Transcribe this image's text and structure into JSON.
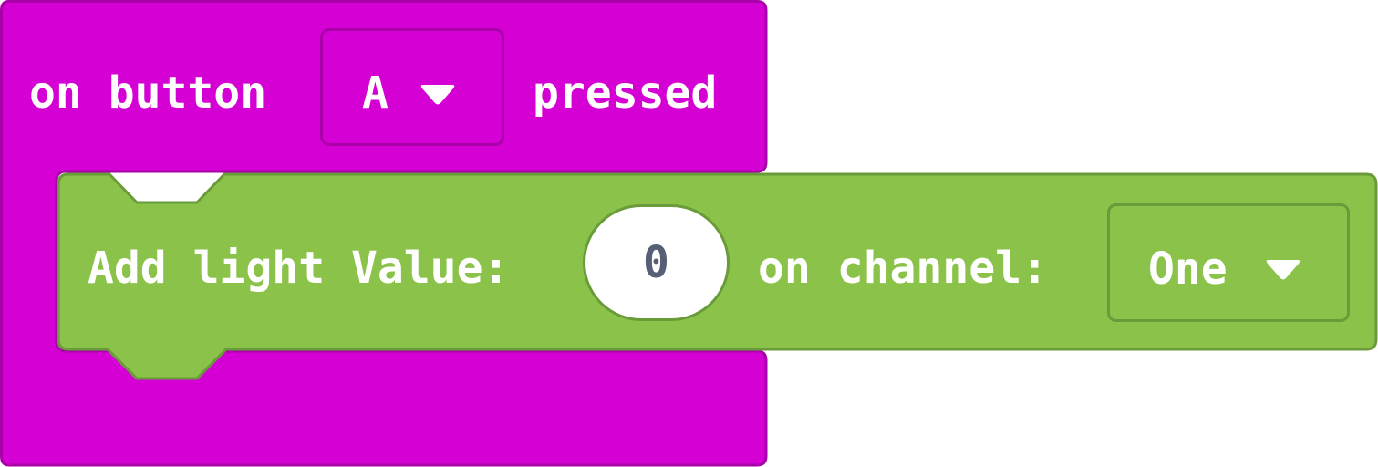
{
  "colors": {
    "event_block_fill": "#d400d4",
    "event_block_stroke": "#aa00aa",
    "statement_block_fill": "#8bc34a",
    "statement_block_stroke": "#6a9b3a",
    "text": "#ffffff",
    "number_text": "#575e75"
  },
  "event_block": {
    "label_prefix": "on button",
    "button_dropdown": {
      "selected": "A",
      "icon": "chevron-down-icon"
    },
    "label_suffix": "pressed"
  },
  "statement_block": {
    "label_prefix": "Add light Value:",
    "value_input": "0",
    "label_mid": "on channel:",
    "channel_dropdown": {
      "selected": "One",
      "icon": "chevron-down-icon"
    }
  }
}
